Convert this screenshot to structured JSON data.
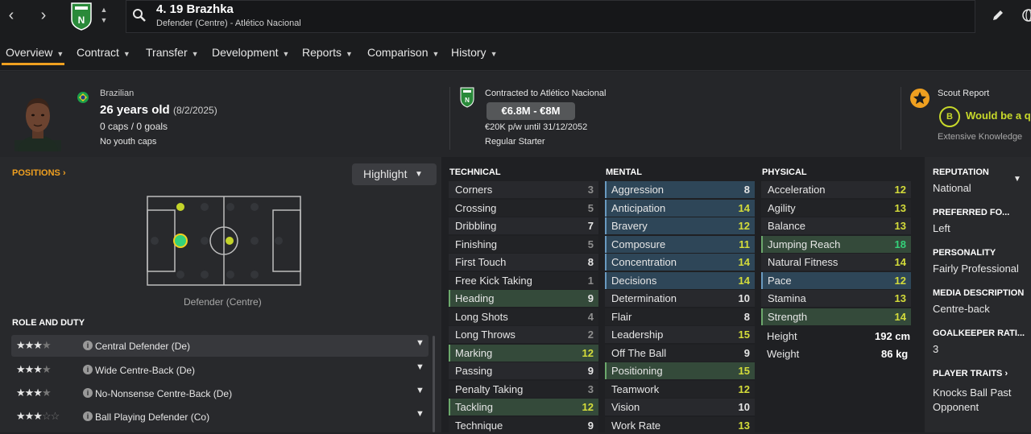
{
  "topbar": {
    "player_name": "4. 19 Brazhka",
    "player_sub": "Defender (Centre) - Atlético Nacional"
  },
  "tabs": [
    {
      "label": "Overview"
    },
    {
      "label": "Contract"
    },
    {
      "label": "Transfer"
    },
    {
      "label": "Development"
    },
    {
      "label": "Reports"
    },
    {
      "label": "Comparison"
    },
    {
      "label": "History"
    }
  ],
  "header": {
    "nationality": "Brazilian",
    "age": "26 years old",
    "dob": "(8/2/2025)",
    "caps": "0 caps / 0 goals",
    "youth_caps": "No youth caps",
    "contract_label": "Contracted to Atlético Nacional",
    "value": "€6.8M - €8M",
    "wage": "€20K p/w until 31/12/2052",
    "squad_status": "Regular Starter",
    "scout_title": "Scout Report",
    "scout_grade": "B",
    "scout_text": "Would be a qu",
    "scout_knowledge": "Extensive Knowledge"
  },
  "positions": {
    "label": "POSITIONS",
    "highlight_label": "Highlight",
    "caption": "Defender (Centre)"
  },
  "roles": {
    "heading": "ROLE AND DUTY",
    "items": [
      {
        "stars": "★★★",
        "name": "Central Defender (De)"
      },
      {
        "stars": "★★★",
        "name": "Wide Centre-Back (De)"
      },
      {
        "stars": "★★★",
        "name": "No-Nonsense Centre-Back (De)"
      },
      {
        "stars": "★★★",
        "name": "Ball Playing Defender (Co)"
      }
    ]
  },
  "attributes": {
    "technical_head": "TECHNICAL",
    "mental_head": "MENTAL",
    "physical_head": "PHYSICAL",
    "technical": [
      {
        "name": "Corners",
        "value": "3"
      },
      {
        "name": "Crossing",
        "value": "5"
      },
      {
        "name": "Dribbling",
        "value": "7"
      },
      {
        "name": "Finishing",
        "value": "5"
      },
      {
        "name": "First Touch",
        "value": "8"
      },
      {
        "name": "Free Kick Taking",
        "value": "1"
      },
      {
        "name": "Heading",
        "value": "9"
      },
      {
        "name": "Long Shots",
        "value": "4"
      },
      {
        "name": "Long Throws",
        "value": "2"
      },
      {
        "name": "Marking",
        "value": "12"
      },
      {
        "name": "Passing",
        "value": "9"
      },
      {
        "name": "Penalty Taking",
        "value": "3"
      },
      {
        "name": "Tackling",
        "value": "12"
      },
      {
        "name": "Technique",
        "value": "9"
      }
    ],
    "mental": [
      {
        "name": "Aggression",
        "value": "8"
      },
      {
        "name": "Anticipation",
        "value": "14"
      },
      {
        "name": "Bravery",
        "value": "12"
      },
      {
        "name": "Composure",
        "value": "11"
      },
      {
        "name": "Concentration",
        "value": "14"
      },
      {
        "name": "Decisions",
        "value": "14"
      },
      {
        "name": "Determination",
        "value": "10"
      },
      {
        "name": "Flair",
        "value": "8"
      },
      {
        "name": "Leadership",
        "value": "15"
      },
      {
        "name": "Off The Ball",
        "value": "9"
      },
      {
        "name": "Positioning",
        "value": "15"
      },
      {
        "name": "Teamwork",
        "value": "12"
      },
      {
        "name": "Vision",
        "value": "10"
      },
      {
        "name": "Work Rate",
        "value": "13"
      }
    ],
    "physical": [
      {
        "name": "Acceleration",
        "value": "12"
      },
      {
        "name": "Agility",
        "value": "13"
      },
      {
        "name": "Balance",
        "value": "13"
      },
      {
        "name": "Jumping Reach",
        "value": "18"
      },
      {
        "name": "Natural Fitness",
        "value": "14"
      },
      {
        "name": "Pace",
        "value": "12"
      },
      {
        "name": "Stamina",
        "value": "13"
      },
      {
        "name": "Strength",
        "value": "14"
      }
    ],
    "height_label": "Height",
    "height_value": "192 cm",
    "weight_label": "Weight",
    "weight_value": "86 kg"
  },
  "right_panel": {
    "reputation_head": "REPUTATION",
    "reputation_value": "National",
    "foot_head": "PREFERRED FO...",
    "foot_value": "Left",
    "personality_head": "PERSONALITY",
    "personality_value": "Fairly Professional",
    "media_head": "MEDIA DESCRIPTION",
    "media_value": "Centre-back",
    "gk_head": "GOALKEEPER RATI...",
    "gk_value": "3",
    "traits_head": "PLAYER TRAITS",
    "traits_value1": "Knocks Ball Past",
    "traits_value2": "Opponent"
  },
  "colors": {
    "accent": "#f0a020",
    "attr_high": "#d4dc3a",
    "attr_top": "#34d27a",
    "club_green": "#2a8a3a"
  }
}
